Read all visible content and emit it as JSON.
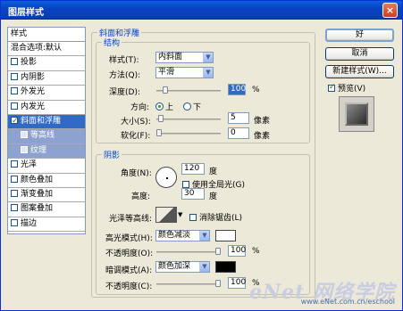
{
  "window": {
    "title": "图层样式",
    "close": "×"
  },
  "styles": {
    "header": "样式",
    "items": [
      {
        "label": "混合选项:默认",
        "checkbox": false,
        "checked": false,
        "selected": false,
        "sub": false
      },
      {
        "label": "投影",
        "checkbox": true,
        "checked": false,
        "selected": false,
        "sub": false
      },
      {
        "label": "内阴影",
        "checkbox": true,
        "checked": false,
        "selected": false,
        "sub": false
      },
      {
        "label": "外发光",
        "checkbox": true,
        "checked": false,
        "selected": false,
        "sub": false
      },
      {
        "label": "内发光",
        "checkbox": true,
        "checked": false,
        "selected": false,
        "sub": false
      },
      {
        "label": "斜面和浮雕",
        "checkbox": true,
        "checked": true,
        "selected": true,
        "sub": false
      },
      {
        "label": "等高线",
        "checkbox": true,
        "checked": false,
        "selected": false,
        "sub": true
      },
      {
        "label": "纹理",
        "checkbox": true,
        "checked": false,
        "selected": false,
        "sub": true
      },
      {
        "label": "光泽",
        "checkbox": true,
        "checked": false,
        "selected": false,
        "sub": false
      },
      {
        "label": "颜色叠加",
        "checkbox": true,
        "checked": false,
        "selected": false,
        "sub": false
      },
      {
        "label": "渐变叠加",
        "checkbox": true,
        "checked": false,
        "selected": false,
        "sub": false
      },
      {
        "label": "图案叠加",
        "checkbox": true,
        "checked": false,
        "selected": false,
        "sub": false
      },
      {
        "label": "描边",
        "checkbox": true,
        "checked": false,
        "selected": false,
        "sub": false
      }
    ]
  },
  "bevel": {
    "group_label": "斜面和浮雕",
    "structure": {
      "label": "结构",
      "style_label": "样式(T):",
      "style_value": "内斜面",
      "technique_label": "方法(Q):",
      "technique_value": "平滑",
      "depth_label": "深度(D):",
      "depth_value": "100",
      "depth_unit": "%",
      "depth_fraction": 0.1,
      "direction_label": "方向:",
      "direction_up": "上",
      "direction_down": "下",
      "direction_selected": "上",
      "size_label": "大小(S):",
      "size_value": "5",
      "size_unit": "像素",
      "size_fraction": 0.03,
      "soften_label": "软化(F):",
      "soften_value": "0",
      "soften_unit": "像素",
      "soften_fraction": 0.0
    },
    "shading": {
      "label": "阴影",
      "angle_label": "角度(N):",
      "angle_value": "120",
      "angle_unit": "度",
      "global_light_label": "使用全局光(G)",
      "altitude_label": "高度:",
      "altitude_value": "30",
      "altitude_unit": "度",
      "gloss_contour_label": "光泽等高线:",
      "antialias_label": "消除锯齿(L)",
      "highlight_mode_label": "高光模式(H):",
      "highlight_mode_value": "颜色减淡",
      "highlight_color": "#ffffff",
      "highlight_opacity_label": "不透明度(O):",
      "highlight_opacity_value": "100",
      "highlight_opacity_unit": "%",
      "highlight_opacity_fraction": 1.0,
      "shadow_mode_label": "暗调模式(A):",
      "shadow_mode_value": "颜色加深",
      "shadow_color": "#000000",
      "shadow_opacity_label": "不透明度(C):",
      "shadow_opacity_value": "100",
      "shadow_opacity_unit": "%",
      "shadow_opacity_fraction": 1.0
    }
  },
  "buttons": {
    "ok": "好",
    "cancel": "取消",
    "new_style": "新建样式(W)...",
    "preview": "预览(V)"
  },
  "watermark": {
    "big": "eNet 网络学院",
    "small": "www.eNet.com.cn/eschool"
  }
}
